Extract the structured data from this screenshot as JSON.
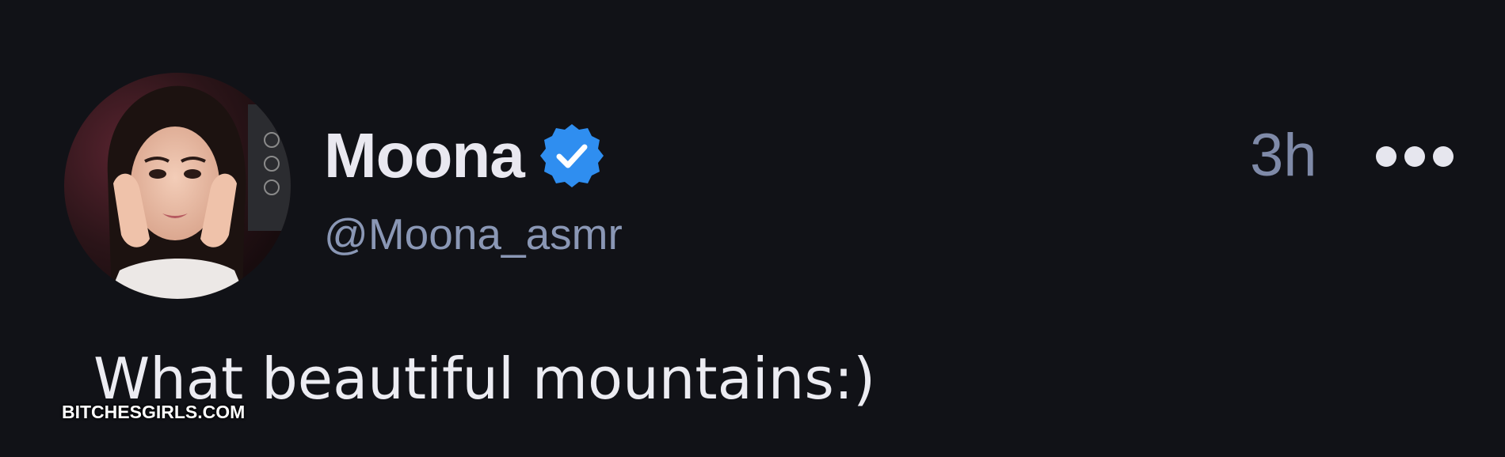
{
  "tweet": {
    "author": {
      "display_name": "Moona",
      "handle": "@Moona_asmr",
      "verified": true,
      "avatar_icon": "profile-photo"
    },
    "timestamp": "3h",
    "more_icon": "more-horizontal-icon",
    "text": "What beautiful mountains:)"
  },
  "watermark": {
    "text": "BITCHESGIRLS.COM"
  },
  "colors": {
    "background": "#111217",
    "display_name": "#e9e8f0",
    "handle": "#8a97b5",
    "timestamp": "#7f8aa8",
    "verified_badge": "#2f8ef0",
    "tweet_text": "#ececf2"
  }
}
